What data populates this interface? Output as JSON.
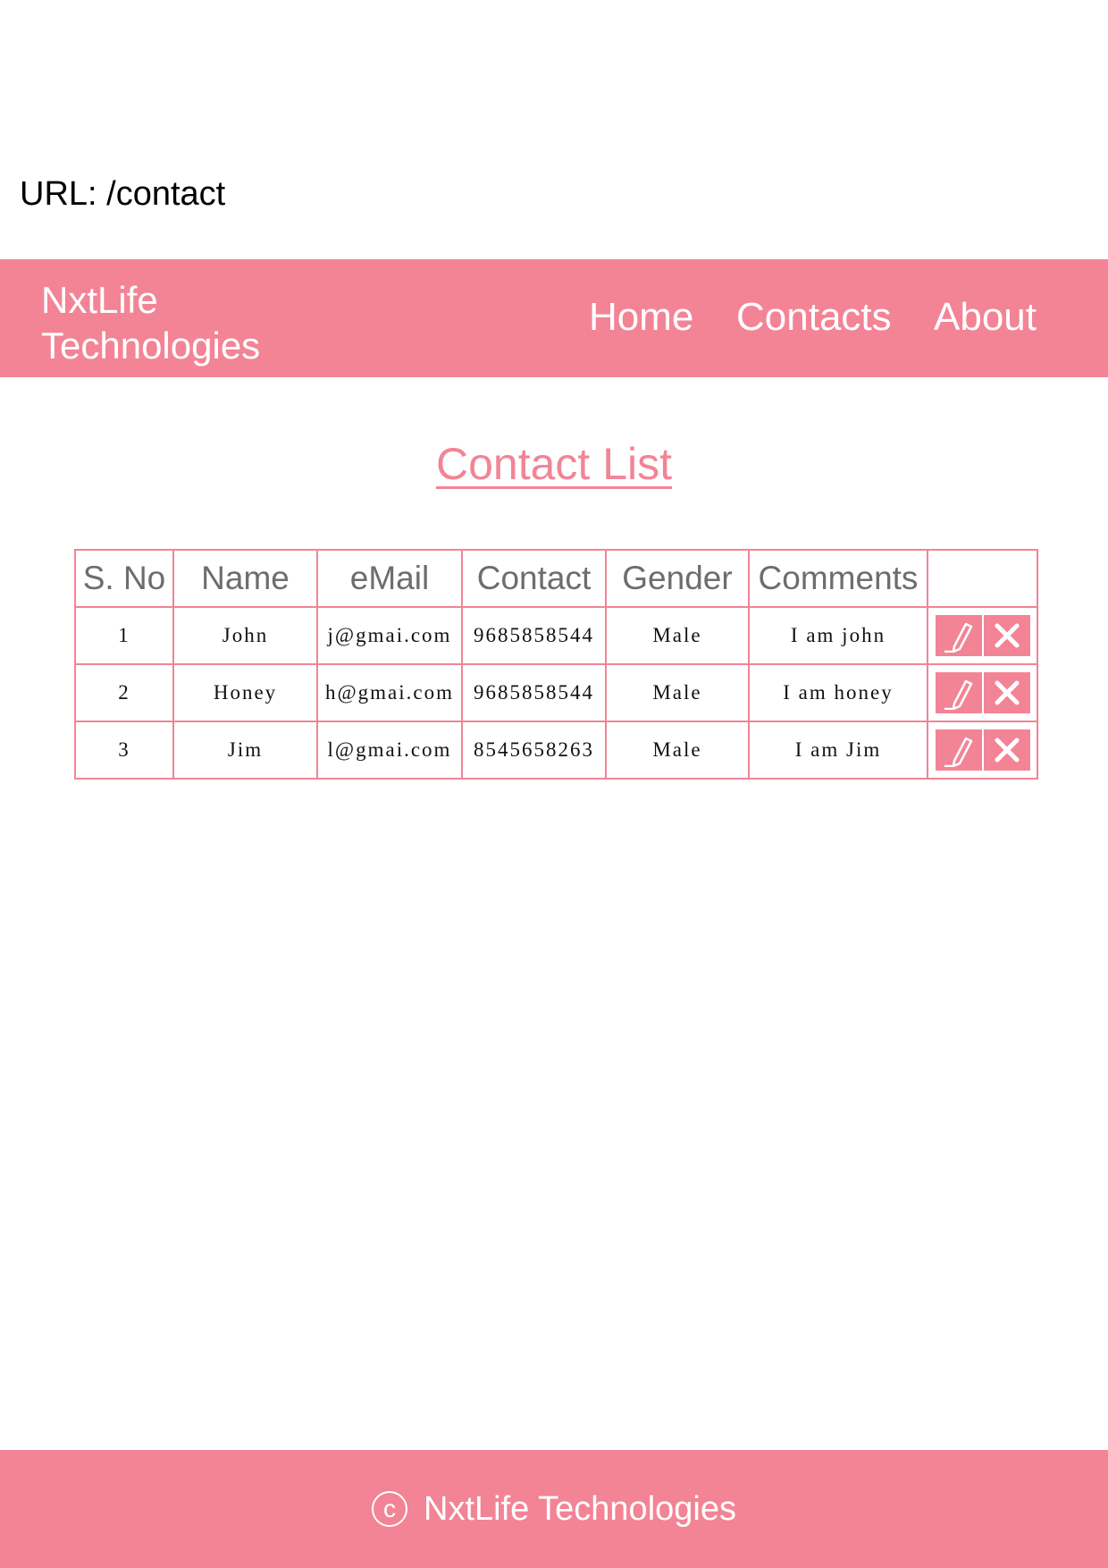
{
  "url_bar": {
    "prefix": "URL",
    "path": ": /contact"
  },
  "navbar": {
    "brand_line1": "NxtLife",
    "brand_line2": "Technologies",
    "links": [
      "Home",
      "Contacts",
      "About"
    ]
  },
  "page_title": "Contact List",
  "table": {
    "headers": [
      "S. No",
      "Name",
      "eMail",
      "Contact",
      "Gender",
      "Comments",
      ""
    ],
    "rows": [
      {
        "sno": "1",
        "name": "John",
        "email": "j@gmai.com",
        "contact": "9685858544",
        "gender": "Male",
        "comments": "I am john"
      },
      {
        "sno": "2",
        "name": "Honey",
        "email": "h@gmai.com",
        "contact": "9685858544",
        "gender": "Male",
        "comments": "I am honey"
      },
      {
        "sno": "3",
        "name": "Jim",
        "email": "l@gmai.com",
        "contact": "8545658263",
        "gender": "Male",
        "comments": "I am Jim"
      }
    ]
  },
  "footer": {
    "icon_symbol": "c",
    "text": "NxtLife Technologies"
  },
  "colors": {
    "accent": "#f28496",
    "header_text": "#6d6d6d"
  },
  "icons": {
    "edit": "pencil-icon",
    "delete": "close-icon",
    "copyright": "copyright-icon"
  }
}
